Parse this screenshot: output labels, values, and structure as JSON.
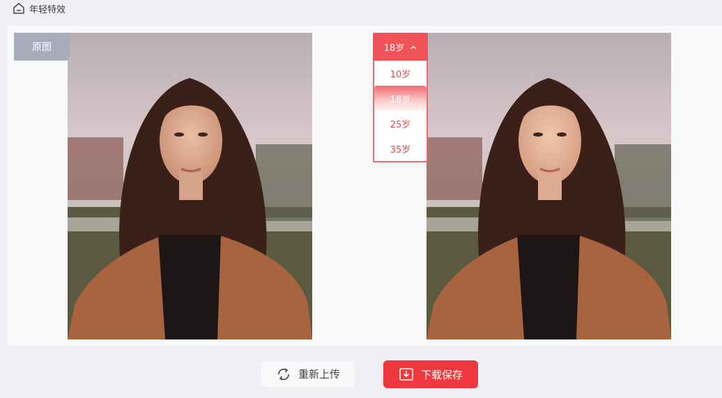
{
  "header": {
    "title": "年轻特效",
    "icon": "home-icon"
  },
  "original": {
    "tag_label": "原图"
  },
  "age_selector": {
    "selected_label": "18岁",
    "options": [
      "10岁",
      "18岁",
      "25岁",
      "35岁"
    ],
    "selected_index": 1
  },
  "actions": {
    "reupload_label": "重新上传",
    "download_label": "下载保存"
  },
  "colors": {
    "accent": "#f0393e",
    "tag_bg": "#a8abbc",
    "option_text": "#e24b4f"
  }
}
